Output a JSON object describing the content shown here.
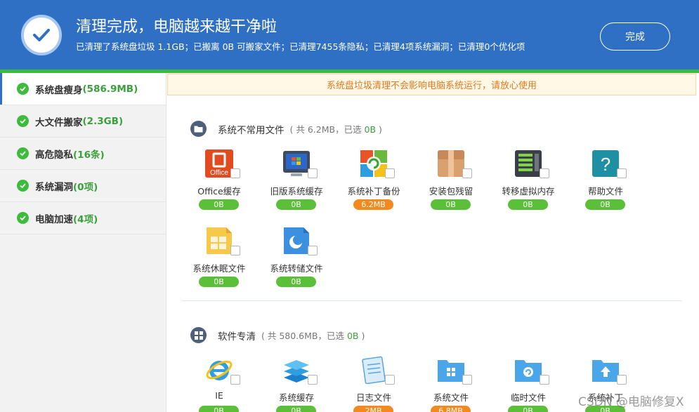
{
  "header": {
    "title": "清理完成，电脑越来越干净啦",
    "subtitle": "已清理了系统盘垃圾 1.1GB；已搬离 0B 可搬家文件；已清理7455条隐私；已清理4项系统漏洞；已清理0个优化项",
    "done_label": "完成"
  },
  "sidebar": {
    "items": [
      {
        "label": "系统盘瘦身",
        "count": "(586.9MB)",
        "active": true
      },
      {
        "label": "大文件搬家",
        "count": "(2.3GB)"
      },
      {
        "label": "高危隐私",
        "count": "(16条)"
      },
      {
        "label": "系统漏洞",
        "count": "(0项)"
      },
      {
        "label": "电脑加速",
        "count": "(4项)"
      }
    ]
  },
  "notice": "系统盘垃圾清理不会影响电脑系统运行，请放心使用",
  "sections": [
    {
      "title": "系统不常用文件",
      "meta_pre": "( 共 6.2MB，已选 ",
      "meta_sel": "0B",
      "meta_post": " )",
      "items": [
        {
          "label": "Office缓存",
          "size": "0B",
          "icon": "office-icon"
        },
        {
          "label": "旧版系统缓存",
          "size": "0B",
          "icon": "monitor-icon"
        },
        {
          "label": "系统补丁备份",
          "size": "6.2MB",
          "icon": "windows-patch-icon",
          "highlight": true
        },
        {
          "label": "安装包残留",
          "size": "0B",
          "icon": "package-box-icon"
        },
        {
          "label": "转移虚拟内存",
          "size": "0B",
          "icon": "memory-chip-icon"
        },
        {
          "label": "帮助文件",
          "size": "0B",
          "icon": "help-question-icon"
        },
        {
          "label": "系统休眠文件",
          "size": "0B",
          "icon": "hibernate-file-icon"
        },
        {
          "label": "系统转储文件",
          "size": "0B",
          "icon": "dump-file-icon"
        }
      ]
    },
    {
      "title": "软件专清",
      "meta_pre": "( 共 580.6MB，已选 ",
      "meta_sel": "0B",
      "meta_post": " )",
      "items": [
        {
          "label": "IE",
          "size": "0B",
          "icon": "ie-browser-icon"
        },
        {
          "label": "系统缓存",
          "size": "0B",
          "icon": "layers-stack-icon"
        },
        {
          "label": "日志文件",
          "size": "2MB",
          "icon": "notepad-log-icon",
          "highlight": true
        },
        {
          "label": "系统文件",
          "size": "6.8MB",
          "icon": "windows-folder-icon",
          "highlight": true
        },
        {
          "label": "临时文件",
          "size": "0B",
          "icon": "temp-folder-icon"
        },
        {
          "label": "系统补丁",
          "size": "0B",
          "icon": "upload-folder-icon"
        }
      ]
    }
  ],
  "watermark": "CSDN @电脑修复X",
  "colors": {
    "header_blue": "#2f6fc4",
    "accent_green": "#3dbb3d",
    "pill_green": "#5cbf3a",
    "pill_orange": "#f28a1d",
    "notice_text": "#e07a1e"
  }
}
